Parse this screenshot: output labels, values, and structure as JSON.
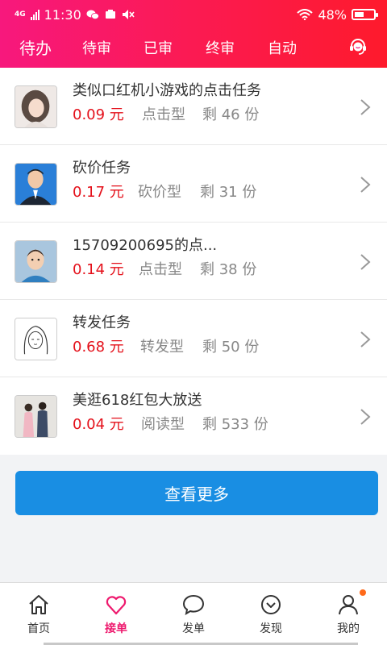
{
  "status_bar": {
    "network": "4G",
    "time": "11:30",
    "battery": "48%",
    "battery_level": 0.48
  },
  "tabs": [
    {
      "label": "待办",
      "active": true
    },
    {
      "label": "待审",
      "active": false
    },
    {
      "label": "已审",
      "active": false
    },
    {
      "label": "终审",
      "active": false
    },
    {
      "label": "自动",
      "active": false
    }
  ],
  "header_icon": "customer-service-icon",
  "tasks": [
    {
      "title": "类似口红机小游戏的点击任务",
      "price": "0.09 元",
      "type": "点击型",
      "remain": "剩 46 份",
      "avatar": "girl-photo"
    },
    {
      "title": "砍价任务",
      "price": "0.17 元",
      "type": "砍价型",
      "remain": "剩 31 份",
      "avatar": "man-suit-photo"
    },
    {
      "title": "15709200695的点...",
      "price": "0.14 元",
      "type": "点击型",
      "remain": "剩 38 份",
      "avatar": "cartoon-man"
    },
    {
      "title": "转发任务",
      "price": "0.68 元",
      "type": "转发型",
      "remain": "剩 50 份",
      "avatar": "sketch-girl"
    },
    {
      "title": "美逛618红包大放送",
      "price": "0.04 元",
      "type": "阅读型",
      "remain": "剩 533 份",
      "avatar": "couple-photo"
    }
  ],
  "more_button": "查看更多",
  "bottom_nav": [
    {
      "label": "首页",
      "icon": "home-icon",
      "active": false
    },
    {
      "label": "接单",
      "icon": "heart-icon",
      "active": true
    },
    {
      "label": "发单",
      "icon": "chat-icon",
      "active": false
    },
    {
      "label": "发现",
      "icon": "discover-icon",
      "active": false
    },
    {
      "label": "我的",
      "icon": "user-icon",
      "active": false,
      "badge": true
    }
  ],
  "colors": {
    "header_start": "#f7187d",
    "header_end": "#fe1a2c",
    "price": "#e4101a",
    "button": "#198ee3",
    "nav_active": "#ee1a6e"
  }
}
